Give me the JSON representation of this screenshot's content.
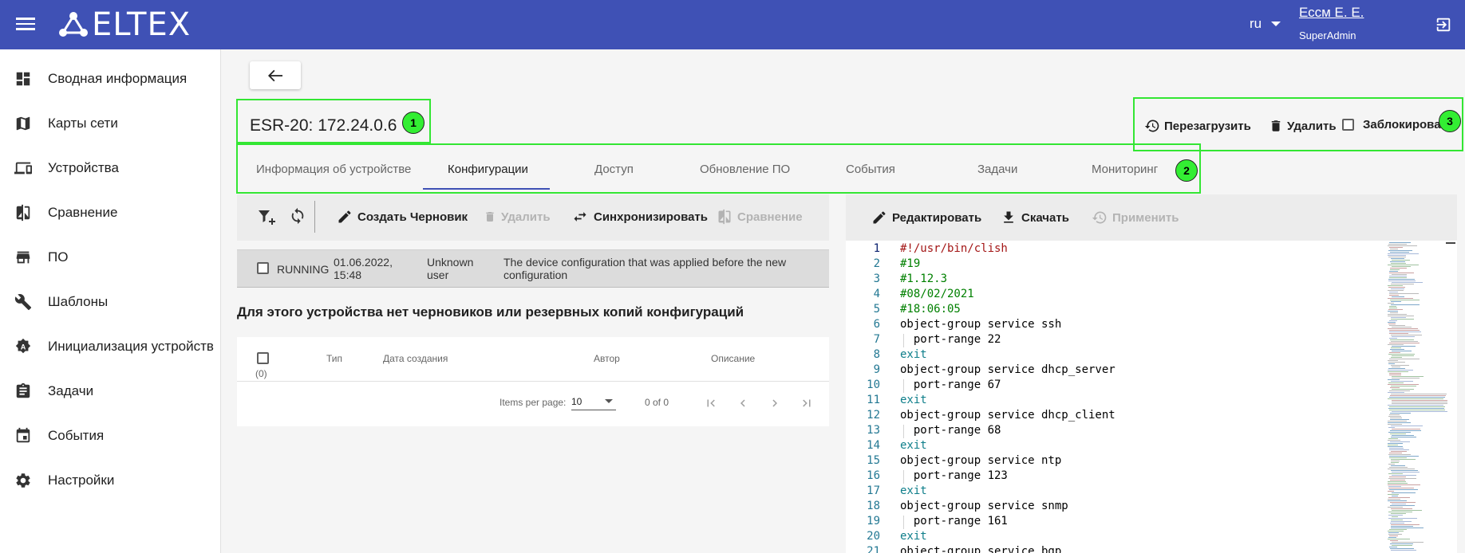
{
  "header": {
    "brand": "ELTEX",
    "language": "ru",
    "user_name": "Ессм Е. Е.",
    "user_role": "SuperAdmin"
  },
  "sidebar": {
    "items": [
      {
        "label": "Сводная информация",
        "icon": "dashboard-icon"
      },
      {
        "label": "Карты сети",
        "icon": "map-icon"
      },
      {
        "label": "Устройства",
        "icon": "devices-icon"
      },
      {
        "label": "Сравнение",
        "icon": "compare-icon"
      },
      {
        "label": "ПО",
        "icon": "software-icon"
      },
      {
        "label": "Шаблоны",
        "icon": "wrench-icon"
      },
      {
        "label": "Инициализация устройств",
        "icon": "initialization-icon"
      },
      {
        "label": "Задачи",
        "icon": "clipboard-icon"
      },
      {
        "label": "События",
        "icon": "calendar-icon"
      },
      {
        "label": "Настройки",
        "icon": "gear-icon"
      }
    ]
  },
  "device": {
    "title": "ESR-20: 172.24.0.6"
  },
  "actions": {
    "reboot": "Перезагрузить",
    "delete": "Удалить",
    "blocked": "Заблокировано"
  },
  "callouts": {
    "one": "1",
    "two": "2",
    "three": "3"
  },
  "tabs": [
    {
      "label": "Информация об устройстве"
    },
    {
      "label": "Конфигурации"
    },
    {
      "label": "Доступ"
    },
    {
      "label": "Обновление ПО"
    },
    {
      "label": "События"
    },
    {
      "label": "Задачи"
    },
    {
      "label": "Мониторинг"
    }
  ],
  "config_toolbar": {
    "create_draft": "Создать Черновик",
    "delete": "Удалить",
    "sync": "Синхронизировать",
    "compare": "Сравнение"
  },
  "running": {
    "name": "RUNNING",
    "date": "01.06.2022,",
    "time": "15:48",
    "author_line1": "Unknown",
    "author_line2": "user",
    "desc_line1": "The device configuration that was applied before the new",
    "desc_line2": "configuration"
  },
  "empty_message": "Для этого устройства нет черновиков или резервных копий конфигураций",
  "table": {
    "count": "(0)",
    "columns": [
      "Тип",
      "Дата создания",
      "Автор",
      "Описание"
    ],
    "items_per_page_label": "Items per page:",
    "items_per_page": "10",
    "range": "0 of 0"
  },
  "editor_toolbar": {
    "edit": "Редактировать",
    "download": "Скачать",
    "apply": "Применить"
  },
  "code_lines": [
    {
      "n": "1",
      "text": "#!/usr/bin/clish",
      "style": "red"
    },
    {
      "n": "2",
      "text": "#19",
      "style": "green"
    },
    {
      "n": "3",
      "text": "#1.12.3",
      "style": "green"
    },
    {
      "n": "4",
      "text": "#08/02/2021",
      "style": "green"
    },
    {
      "n": "5",
      "text": "#18:06:05",
      "style": "green"
    },
    {
      "n": "6",
      "text": "object-group service ssh",
      "style": "plain"
    },
    {
      "n": "7",
      "text": "  port-range 22",
      "style": "plain"
    },
    {
      "n": "8",
      "text": "exit",
      "style": "kw"
    },
    {
      "n": "9",
      "text": "object-group service dhcp_server",
      "style": "plain"
    },
    {
      "n": "10",
      "text": "  port-range 67",
      "style": "plain"
    },
    {
      "n": "11",
      "text": "exit",
      "style": "kw"
    },
    {
      "n": "12",
      "text": "object-group service dhcp_client",
      "style": "plain"
    },
    {
      "n": "13",
      "text": "  port-range 68",
      "style": "plain"
    },
    {
      "n": "14",
      "text": "exit",
      "style": "kw"
    },
    {
      "n": "15",
      "text": "object-group service ntp",
      "style": "plain"
    },
    {
      "n": "16",
      "text": "  port-range 123",
      "style": "plain"
    },
    {
      "n": "17",
      "text": "exit",
      "style": "kw"
    },
    {
      "n": "18",
      "text": "object-group service snmp",
      "style": "plain"
    },
    {
      "n": "19",
      "text": "  port-range 161",
      "style": "plain"
    },
    {
      "n": "20",
      "text": "exit",
      "style": "kw"
    },
    {
      "n": "21",
      "text": "object-group service bgp",
      "style": "plain"
    }
  ],
  "colors": {
    "primary": "#3f51b5",
    "callout": "#33ee33",
    "code_red": "#a31515",
    "code_green": "#008000",
    "code_kw": "#0e7e8a",
    "line_number": "#237893"
  }
}
